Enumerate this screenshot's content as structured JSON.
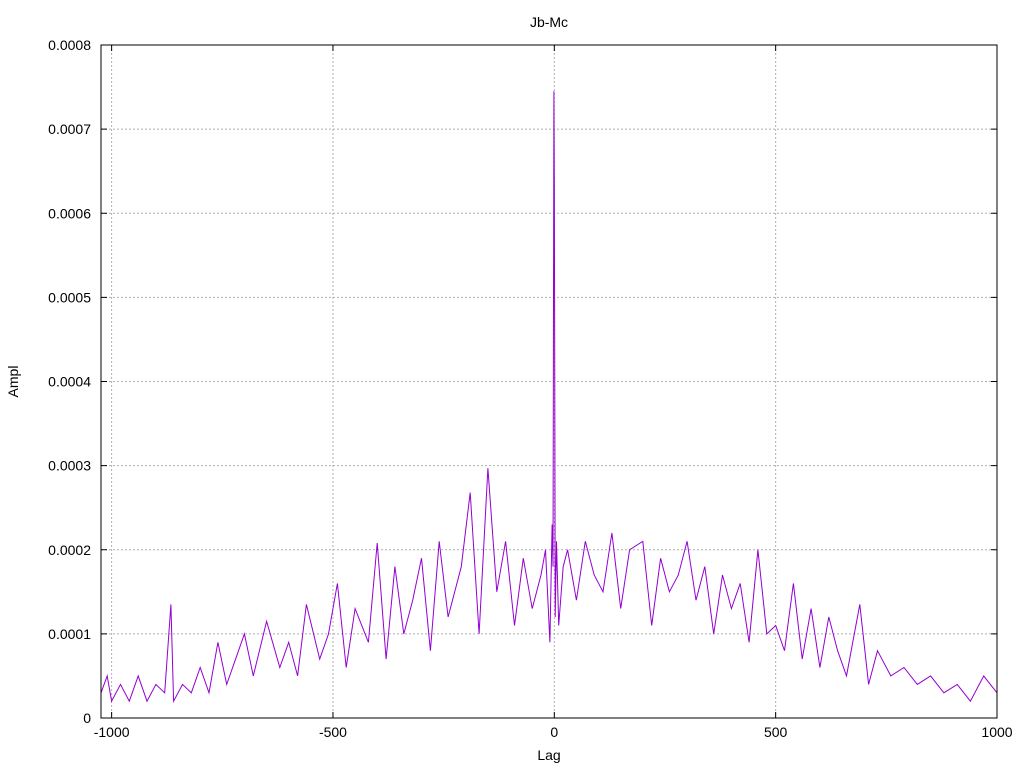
{
  "chart_data": {
    "type": "line",
    "title": "Jb-Mc",
    "xlabel": "Lag",
    "ylabel": "Ampl",
    "xlim": [
      -1024,
      1000
    ],
    "ylim": [
      0,
      0.0008
    ],
    "grid": true,
    "line_color": "#9400d3",
    "xticks": [
      -1000,
      -500,
      0,
      500,
      1000
    ],
    "xtick_labels": [
      "-1000",
      "-500",
      "0",
      "500",
      "1000"
    ],
    "yticks": [
      0,
      0.0001,
      0.0002,
      0.0003,
      0.0004,
      0.0005,
      0.0006,
      0.0007,
      0.0008
    ],
    "ytick_labels": [
      "0",
      "0.0001",
      "0.0002",
      "0.0003",
      "0.0004",
      "0.0005",
      "0.0006",
      "0.0007",
      "0.0008"
    ],
    "series": [
      {
        "x": [
          -1024,
          -1010,
          -1000,
          -980,
          -960,
          -940,
          -920,
          -900,
          -880,
          -866,
          -860,
          -840,
          -820,
          -800,
          -780,
          -760,
          -740,
          -720,
          -700,
          -680,
          -650,
          -620,
          -600,
          -580,
          -560,
          -530,
          -510,
          -490,
          -470,
          -450,
          -420,
          -400,
          -380,
          -360,
          -340,
          -320,
          -300,
          -280,
          -260,
          -240,
          -210,
          -190,
          -170,
          -150,
          -130,
          -110,
          -90,
          -70,
          -50,
          -30,
          -20,
          -10,
          -5,
          -3,
          -1,
          0,
          1,
          2,
          5,
          10,
          20,
          30,
          50,
          70,
          90,
          110,
          130,
          150,
          170,
          200,
          220,
          240,
          260,
          280,
          300,
          320,
          340,
          360,
          380,
          400,
          420,
          440,
          460,
          480,
          500,
          520,
          540,
          560,
          580,
          600,
          620,
          640,
          660,
          690,
          710,
          730,
          760,
          790,
          820,
          850,
          880,
          910,
          940,
          970,
          1000
        ],
        "y": [
          3e-05,
          5e-05,
          2e-05,
          4e-05,
          2e-05,
          5e-05,
          2e-05,
          4e-05,
          3e-05,
          0.000135,
          2e-05,
          4e-05,
          3e-05,
          6e-05,
          3e-05,
          9e-05,
          4e-05,
          7e-05,
          0.0001,
          5e-05,
          0.000115,
          6e-05,
          9e-05,
          5e-05,
          0.000135,
          7e-05,
          0.0001,
          0.00016,
          6e-05,
          0.00013,
          9e-05,
          0.000208,
          7e-05,
          0.00018,
          0.0001,
          0.00014,
          0.00019,
          8e-05,
          0.00021,
          0.00012,
          0.00018,
          0.000268,
          0.0001,
          0.000297,
          0.00015,
          0.00021,
          0.00011,
          0.00019,
          0.00013,
          0.00017,
          0.0002,
          9e-05,
          0.00023,
          0.00018,
          0.000745,
          0.00064,
          0.00039,
          0.00012,
          0.00021,
          0.00011,
          0.00018,
          0.0002,
          0.00014,
          0.00021,
          0.00017,
          0.00015,
          0.00022,
          0.00013,
          0.0002,
          0.00021,
          0.00011,
          0.00019,
          0.00015,
          0.00017,
          0.00021,
          0.00014,
          0.00018,
          0.0001,
          0.00017,
          0.00013,
          0.00016,
          9e-05,
          0.0002,
          0.0001,
          0.00011,
          8e-05,
          0.00016,
          7e-05,
          0.00013,
          6e-05,
          0.00012,
          8e-05,
          5e-05,
          0.000135,
          4e-05,
          8e-05,
          5e-05,
          6e-05,
          4e-05,
          5e-05,
          3e-05,
          4e-05,
          2e-05,
          5e-05,
          3e-05
        ]
      }
    ]
  }
}
